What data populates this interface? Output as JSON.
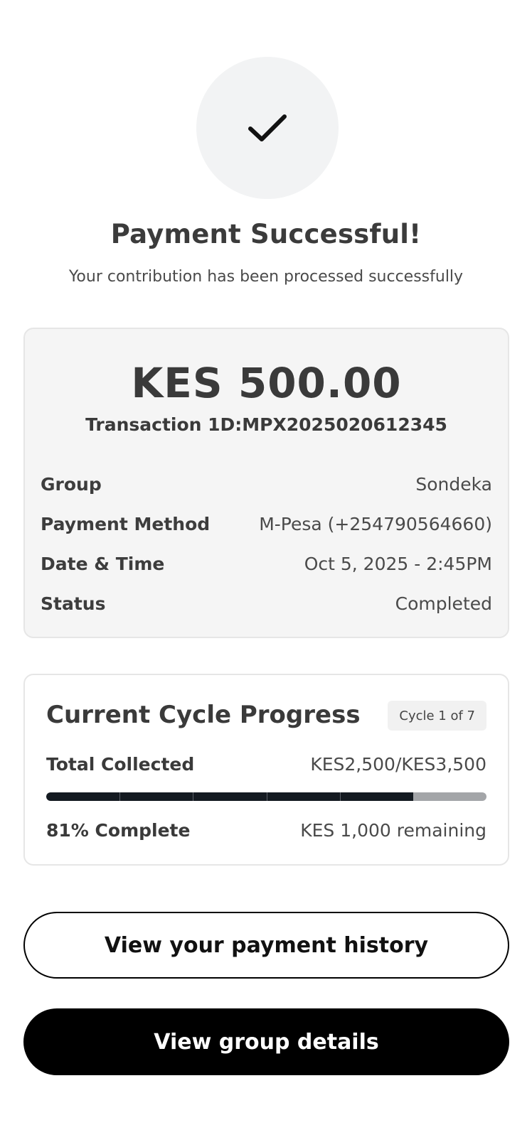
{
  "header": {
    "icon": "check-icon",
    "title": "Payment Successful!",
    "subtitle": "Your contribution has been processed successfully"
  },
  "receipt": {
    "amount": "KES 500.00",
    "transaction_id": "Transaction 1D:MPX2025020612345",
    "details": [
      {
        "label": "Group",
        "value": "Sondeka"
      },
      {
        "label": "Payment Method",
        "value": "M-Pesa (+254790564660)"
      },
      {
        "label": "Date & Time",
        "value": "Oct 5, 2025 - 2:45PM"
      },
      {
        "label": "Status",
        "value": "Completed"
      }
    ]
  },
  "progress": {
    "title": "Current Cycle Progress",
    "cycle_badge": "Cycle 1 of 7",
    "total_label": "Total Collected",
    "total_value": "KES2,500/KES3,500",
    "percent_label": "81% Complete",
    "remaining": "KES 1,000 remaining",
    "fill_fraction": 0.834,
    "segment_count": 5
  },
  "actions": {
    "history_label": "View your payment history",
    "group_label": "View group details"
  },
  "colors": {
    "bar_fill": "#141a21",
    "bar_track": "#a3a5a8",
    "primary_button": "#000000"
  }
}
